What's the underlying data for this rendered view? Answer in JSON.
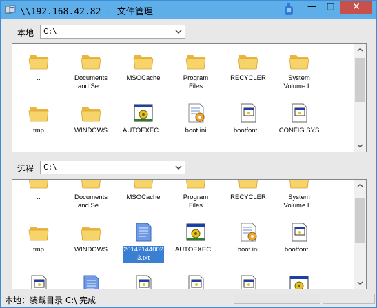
{
  "window": {
    "title": "\\\\192.168.42.82 - 文件管理"
  },
  "titlebar": {
    "min": "—",
    "max": "□",
    "close": "✕"
  },
  "local": {
    "label": "本地",
    "path": "C:\\",
    "items": [
      {
        "label": "..",
        "icon": "folder-icon",
        "selected": false
      },
      {
        "label": "Documents\nand Se...",
        "icon": "folder-icon",
        "selected": false
      },
      {
        "label": "MSOCache",
        "icon": "folder-icon",
        "selected": false
      },
      {
        "label": "Program\nFiles",
        "icon": "folder-icon",
        "selected": false
      },
      {
        "label": "RECYCLER",
        "icon": "folder-icon",
        "selected": false
      },
      {
        "label": "System\nVolume I...",
        "icon": "folder-icon",
        "selected": false
      },
      {
        "label": "tmp",
        "icon": "folder-icon",
        "selected": false
      },
      {
        "label": "WINDOWS",
        "icon": "folder-icon",
        "selected": false
      },
      {
        "label": "AUTOEXEC...",
        "icon": "bat-file-icon",
        "selected": false
      },
      {
        "label": "boot.ini",
        "icon": "ini-file-icon",
        "selected": false
      },
      {
        "label": "bootfont...",
        "icon": "system-file-icon",
        "selected": false
      },
      {
        "label": "CONFIG.SYS",
        "icon": "system-file-icon",
        "selected": false
      }
    ]
  },
  "remote": {
    "label": "远程",
    "path": "C:\\",
    "items": [
      {
        "label": "..",
        "icon": "folder-icon",
        "selected": false
      },
      {
        "label": "Documents\nand Se...",
        "icon": "folder-icon",
        "selected": false
      },
      {
        "label": "MSOCache",
        "icon": "folder-icon",
        "selected": false
      },
      {
        "label": "Program\nFiles",
        "icon": "folder-icon",
        "selected": false
      },
      {
        "label": "RECYCLER",
        "icon": "folder-icon",
        "selected": false
      },
      {
        "label": "System\nVolume I...",
        "icon": "folder-icon",
        "selected": false
      },
      {
        "label": "tmp",
        "icon": "folder-icon",
        "selected": false
      },
      {
        "label": "WINDOWS",
        "icon": "folder-icon",
        "selected": false
      },
      {
        "label": "20142144002\n3.txt",
        "icon": "text-file-icon",
        "selected": true
      },
      {
        "label": "AUTOEXEC...",
        "icon": "bat-file-icon",
        "selected": false
      },
      {
        "label": "boot.ini",
        "icon": "ini-file-icon",
        "selected": false
      },
      {
        "label": "bootfont...",
        "icon": "system-file-icon",
        "selected": false
      }
    ]
  },
  "status": {
    "text": "本地：装载目录 C:\\ 完成",
    "progress": 0
  },
  "colors": {
    "titlebar": "#5eaee9",
    "close": "#c7504a",
    "selection": "#3b7fd3",
    "folder": "#f5cf5e"
  }
}
